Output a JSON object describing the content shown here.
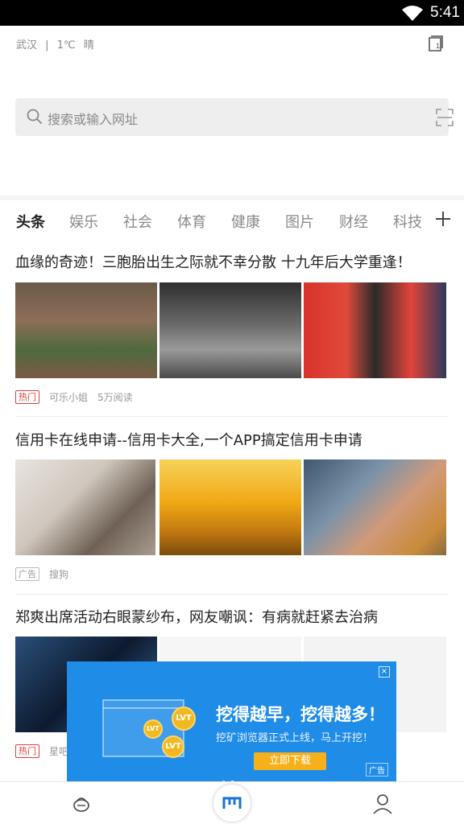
{
  "status": {
    "time": "5:41"
  },
  "header": {
    "city": "武汉",
    "divider": "|",
    "temperature": "1℃",
    "condition": "晴",
    "tab_count": "1"
  },
  "search": {
    "placeholder": "搜索或输入网址"
  },
  "categories": [
    "头条",
    "娱乐",
    "社会",
    "体育",
    "健康",
    "图片",
    "财经",
    "科技"
  ],
  "articles": [
    {
      "title": "血缘的奇迹！三胞胎出生之际就不幸分散 十九年后大学重逢！",
      "tag": "热门",
      "source": "可乐小姐",
      "reads": "5万阅读"
    },
    {
      "title": "信用卡在线申请--信用卡大全,一个APP搞定信用卡申请",
      "tag": "广告",
      "source": "搜狗"
    },
    {
      "title": "郑爽出席活动右眼蒙纱布，网友嘲讽：有病就赶紧去治病",
      "tag": "热门",
      "source": "星吧"
    }
  ],
  "banner": {
    "title": "挖得越早，挖得越多！",
    "subtitle": "挖矿浏览器正式上线，马上开挖！",
    "cta": "立即下载",
    "ad_label": "广告",
    "coin_text": "LVT",
    "close": "×"
  },
  "colors": {
    "hot": "#e0433a",
    "banner_bg": "#1f8ce8",
    "cta": "#f5b01c",
    "brand": "#1a73d9"
  }
}
